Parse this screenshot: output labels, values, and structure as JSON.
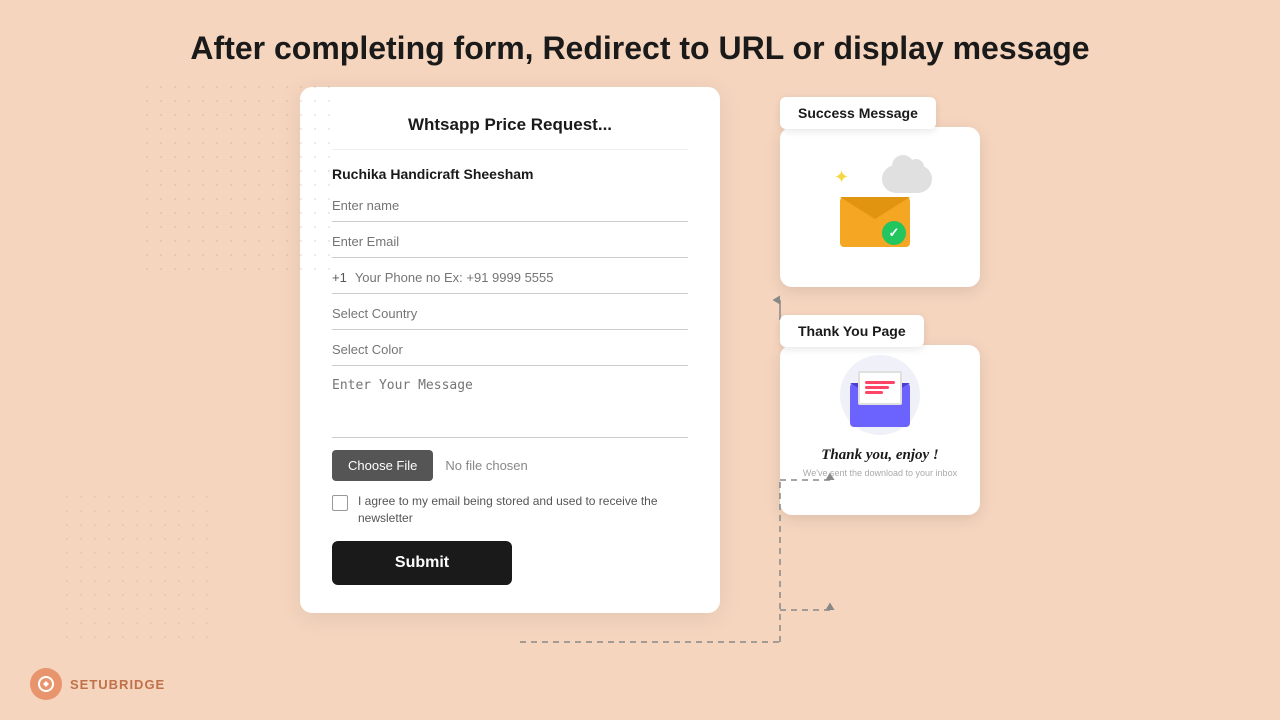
{
  "page": {
    "title": "After completing form, Redirect to URL or display message",
    "bg_color": "#f5d5be"
  },
  "form": {
    "title": "Whtsapp Price Request...",
    "subtitle": "Ruchika Handicraft Sheesham",
    "fields": {
      "name_placeholder": "Enter name",
      "email_placeholder": "Enter Email",
      "phone_prefix": "+1",
      "phone_placeholder": "Your Phone no Ex: +91 9999 5555",
      "country_placeholder": "Select Country",
      "color_placeholder": "Select Color",
      "message_placeholder": "Enter Your Message"
    },
    "file": {
      "button_label": "Choose File",
      "no_file_text": "No file chosen"
    },
    "checkbox_label": "I agree to my email being stored and used to receive the newsletter",
    "submit_label": "Submit"
  },
  "success_panel": {
    "tab_label": "Success Message"
  },
  "thankyou_panel": {
    "tab_label": "Thank You Page",
    "heading": "Thank you, enjoy !",
    "subtext": "We've sent the download to your inbox"
  },
  "logo": {
    "text": "SETUBRIDGE"
  }
}
